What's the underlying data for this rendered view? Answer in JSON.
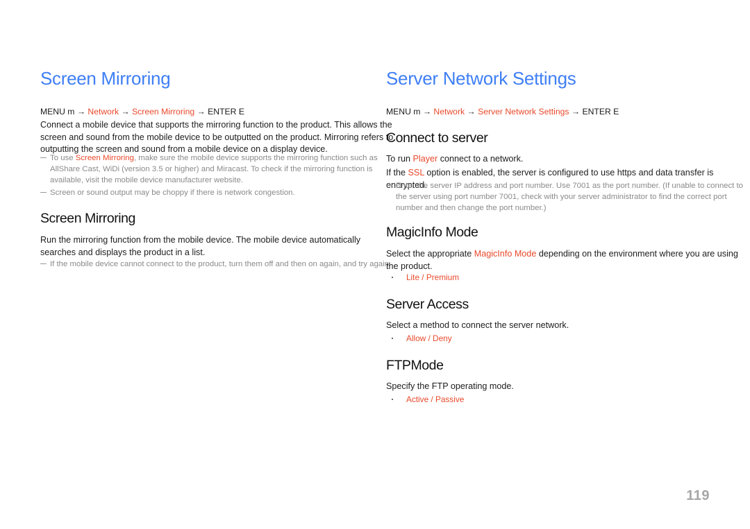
{
  "page": {
    "number": "119",
    "accent_heading_color": "#3f7ff5",
    "accent_option_color": "#e8492b",
    "note_color": "#8a8a8a"
  },
  "left_column": {
    "title": "Screen Mirroring",
    "menu_path": {
      "prefix": "MENU ",
      "menu_key": "m",
      "arrow1": " → ",
      "item1": "Network",
      "arrow2": " → ",
      "item2": "Screen Mirroring",
      "arrow3": " → ",
      "suffix": "ENTER ",
      "enter_key": "E"
    },
    "intro": "Connect a mobile device that supports the mirroring function to the product. This allows the screen and sound from the mobile device to be outputted on the product. Mirroring refers to outputting the screen and sound from a mobile device on a display device.",
    "notes": [
      {
        "pre": "To use ",
        "accent": "Screen Mirroring",
        "post": ", make sure the mobile device supports the mirroring function such as AllShare Cast, WiDi (version 3.5 or higher) and Miracast. To check if the mirroring function is available, visit the mobile device manufacturer website."
      },
      {
        "pre": "",
        "accent": "",
        "post": "Screen or sound output may be choppy if there is network congestion."
      }
    ],
    "subsection": {
      "title": "Screen Mirroring",
      "body": "Run the mirroring function from the mobile device. The mobile device automatically searches and displays the product in a list.",
      "note": "If the mobile device cannot connect to the product, turn them off and then on again, and try again."
    }
  },
  "right_column": {
    "title": "Server Network Settings",
    "menu_path": {
      "prefix": "MENU ",
      "menu_key": "m",
      "arrow1": " → ",
      "item1": "Network",
      "arrow2": " → ",
      "item2": "Server Network Settings",
      "arrow3": " → ",
      "suffix": "ENTER ",
      "enter_key": "E"
    },
    "sections": [
      {
        "heading": "Connect to server",
        "line1_pre": "To run ",
        "line1_accent": "Player",
        "line1_post": " connect to a network.",
        "line2_pre": "If the ",
        "line2_accent": "SSL",
        "line2_post": " option is enabled, the server is configured to use https and data transfer is encrypted.",
        "note": "Enter the server IP address and port number. Use 7001 as the port number. (If unable to connect to the server using port number 7001, check with your server administrator to find the correct port number and then change the port number.)"
      },
      {
        "heading": "MagicInfo Mode",
        "body_pre": "Select the appropriate ",
        "body_accent": "MagicInfo Mode",
        "body_post": " depending on the environment where you are using the product.",
        "options": [
          "Lite",
          "Premium"
        ],
        "option_separator": " / "
      },
      {
        "heading": "Server Access",
        "body": "Select a method to connect the server network.",
        "options": [
          "Allow",
          "Deny"
        ],
        "option_separator": " / "
      },
      {
        "heading": "FTPMode",
        "body": "Specify the FTP operating mode.",
        "options": [
          "Active",
          "Passive"
        ],
        "option_separator": " / "
      }
    ]
  }
}
